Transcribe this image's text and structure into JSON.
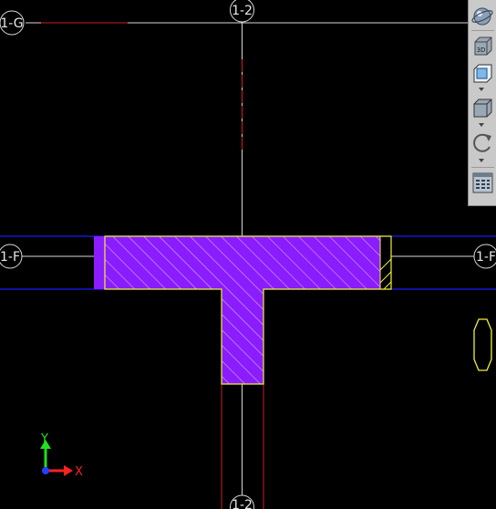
{
  "grid_labels": {
    "top_axis": "1-2",
    "bottom_axis": "1-2",
    "left_top_axis": "1-G",
    "left_mid_axis": "1-F",
    "right_mid_axis": "1-F"
  },
  "ucs": {
    "x_label": "X",
    "y_label": "Y"
  },
  "colors": {
    "background": "#000000",
    "grid_line": "#d8d8d8",
    "beam_line": "#1a1aff",
    "hatch_fill": "#8b1cff",
    "hatch_outline": "#f2f230",
    "hidden_red": "#cc2020",
    "ucs_x": "#ff2020",
    "ucs_y": "#20e020",
    "ucs_origin": "#2040ff"
  },
  "toolbar": {
    "buttons": [
      {
        "icon": "orbit-sphere-icon",
        "label": ""
      },
      {
        "icon": "3d-view-icon",
        "label": "3D"
      },
      {
        "icon": "top-view-cube-icon",
        "label": ""
      },
      {
        "icon": "view-cube-icon",
        "label": ""
      },
      {
        "icon": "rotate-icon",
        "label": ""
      },
      {
        "icon": "view-manager-icon",
        "label": ""
      }
    ]
  }
}
